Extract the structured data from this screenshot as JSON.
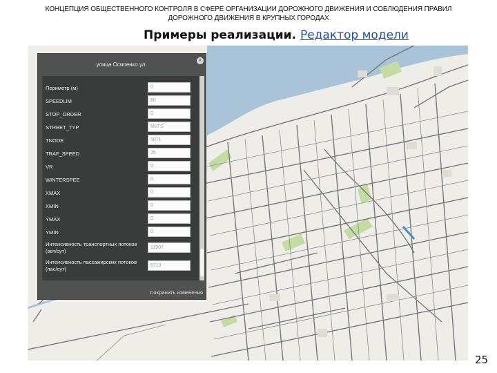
{
  "header": {
    "line1": "КОНЦЕПЦИЯ ОБЩЕСТВЕННОГО КОНТРОЛЯ В СФЕРЕ ОРГАНИЗАЦИИ ДОРОЖНОГО ДВИЖЕНИЯ И СОБЛЮДЕНИЯ ПРАВИЛ",
    "line2": "ДОРОЖНОГО ДВИЖЕНИЯ В КРУПНЫХ ГОРОДАХ"
  },
  "subtitle": {
    "bold": "Примеры реализации.",
    "link": "Редактор модели"
  },
  "panel": {
    "title": "улица Осипенко ул.",
    "close_icon": "close-icon",
    "fields": [
      {
        "label": "Периметр (м)",
        "value": "0"
      },
      {
        "label": "SPEEDLIM",
        "value": "60"
      },
      {
        "label": "STOP_ORDER",
        "value": "0"
      },
      {
        "label": "STREET_TYP",
        "value": "МУГS"
      },
      {
        "label": "TNODE",
        "value": "1071"
      },
      {
        "label": "TRAF_SPEED",
        "value": "25"
      },
      {
        "label": "VR",
        "value": "0"
      },
      {
        "label": "WINTERSPEE",
        "value": "0"
      },
      {
        "label": "XMAX",
        "value": "0"
      },
      {
        "label": "XMIN",
        "value": "0"
      },
      {
        "label": "YMAX",
        "value": "0"
      },
      {
        "label": "YMIN",
        "value": "0"
      },
      {
        "label": "Интенсивность транспортных потоков (авт/сут)",
        "value": "11907"
      },
      {
        "label": "Интенсивность пассажирских потоков (пас/сут)",
        "value": "5713"
      }
    ],
    "save_label": "Сохранить изменения"
  },
  "map": {
    "water_color": "#a9c3d9",
    "land_color": "#eeede7",
    "road_color": "#75787a",
    "park_color": "#c2dca2",
    "highlight_color": "#3f8fd1"
  },
  "page_number": "25"
}
